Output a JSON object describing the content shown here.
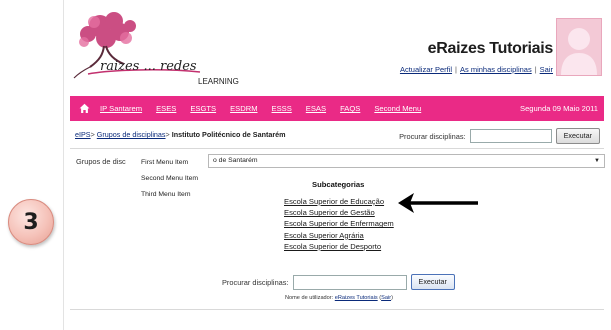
{
  "step_badge": "3",
  "logo": {
    "text_top": "raizes ... redes",
    "text_bottom": "LEARNING"
  },
  "header": {
    "title": "eRaizes Tutoriais",
    "links": [
      "Actualizar Perfil",
      "As minhas disciplinas",
      "Sair"
    ],
    "separator": "|"
  },
  "navbar": {
    "items": [
      "IP Santarem",
      "ESES",
      "ESGTS",
      "ESDRM",
      "ESSS",
      "ESAS",
      "FAQS",
      "Second Menu"
    ],
    "date": "Segunda 09 Maio 2011",
    "colors": {
      "bar": "#ea2a86"
    }
  },
  "breadcrumb": {
    "items": [
      "eIPS",
      "Grupos de disciplinas"
    ],
    "current": "Instituto Politécnico de Santarém",
    "arrow": ">"
  },
  "search_top": {
    "label": "Procurar disciplinas:",
    "value": "",
    "button": "Executar"
  },
  "groups": {
    "label": "Grupos de disc",
    "selected": "o de Santarém",
    "menu_items": [
      "First Menu Item",
      "Second Menu Item",
      "Third Menu Item"
    ]
  },
  "subcategories": {
    "title": "Subcategorias",
    "items": [
      "Escola Superior de Educação",
      "Escola Superior de Gestão",
      "Escola Superior de Enfermagem",
      "Escola Superior Agrária",
      "Escola Superior de Desporto"
    ]
  },
  "search_bottom": {
    "label": "Procurar disciplinas:",
    "value": "",
    "button": "Executar"
  },
  "footer": {
    "prefix": "Nome de utilizador:",
    "user": "eRaizes Tutoriais",
    "logout_open": "(",
    "logout": "Sair",
    "logout_close": ")"
  }
}
